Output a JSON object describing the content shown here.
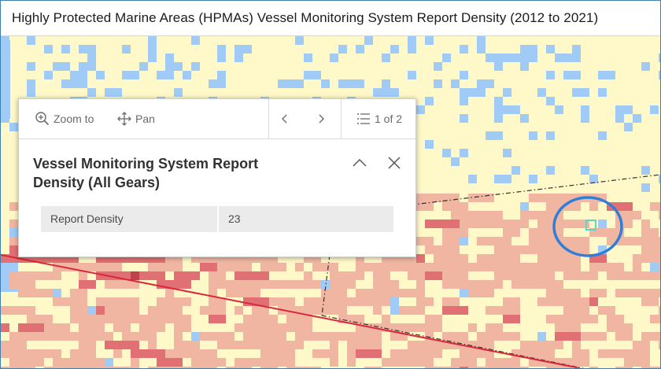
{
  "header": {
    "title": "Highly Protected Marine Areas (HPMAs) Vessel Monitoring System Report Density (2012 to 2021)"
  },
  "map": {
    "colors": {
      "background": "#fff8c8",
      "low_density": "#f0b6a2",
      "medium_density": "#e07074",
      "high_density": "#c0404e",
      "land": "#9fcbf6",
      "boundary_line": "#d8283a",
      "highlight_ring": "#2f7fd8",
      "selected_cell": "#5fd6c0"
    }
  },
  "popup": {
    "toolbar": {
      "zoom_label": "Zoom to",
      "pan_label": "Pan",
      "pager_text": "1 of 2"
    },
    "title": "Vessel Monitoring System Report Density (All Gears)",
    "attributes": [
      {
        "name": "Report Density",
        "value": "23"
      }
    ]
  }
}
